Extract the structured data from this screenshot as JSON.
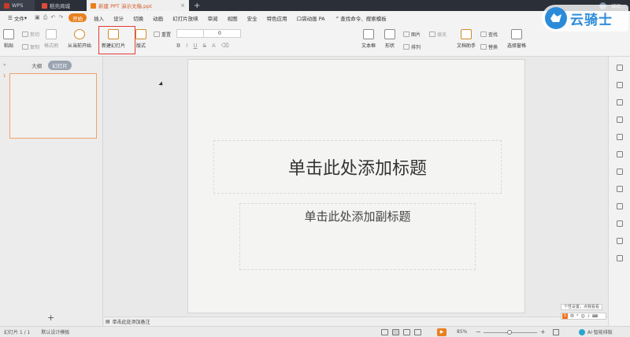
{
  "titlebar": {
    "tabs": [
      {
        "label": "WPS"
      },
      {
        "label": "稻壳商城"
      },
      {
        "label": "新建 PPT 演示文稿.ppt"
      }
    ],
    "user": "诚招…"
  },
  "menu": {
    "file": "文件",
    "items": [
      "开始",
      "插入",
      "设计",
      "切换",
      "动画",
      "幻灯片放映",
      "审阅",
      "视图",
      "安全",
      "特色应用",
      "口袋动画 PA"
    ],
    "search": "查找命令、搜索模板"
  },
  "ribbon": {
    "paste": "粘贴",
    "cut": "剪切",
    "copy": "复制",
    "format_painter": "格式刷",
    "from_current": "从当前开始",
    "new_slide": "新建幻灯片",
    "layout": "版式",
    "reset": "重置",
    "font_size_value": "0",
    "textbox": "文本框",
    "shape": "形状",
    "picture": "图片",
    "fill": "填充",
    "arrange": "排列",
    "doc_assistant": "文档助手",
    "find": "查找",
    "replace": "替换",
    "select_pane": "选择窗格"
  },
  "logo_text": "云骑士",
  "leftpanel": {
    "tab_outline": "大纲",
    "tab_slides": "幻灯片",
    "slide_number": "1"
  },
  "slide": {
    "title_placeholder": "单击此处添加标题",
    "subtitle_placeholder": "单击此处添加副标题"
  },
  "notes": "单击此处添加备注",
  "status": {
    "slide_count": "幻灯片 1 / 1",
    "template": "默认设计模板",
    "zoom": "85%",
    "ai": "AI·智能排版"
  },
  "ime": {
    "tip": "个性设置，点我看看"
  }
}
